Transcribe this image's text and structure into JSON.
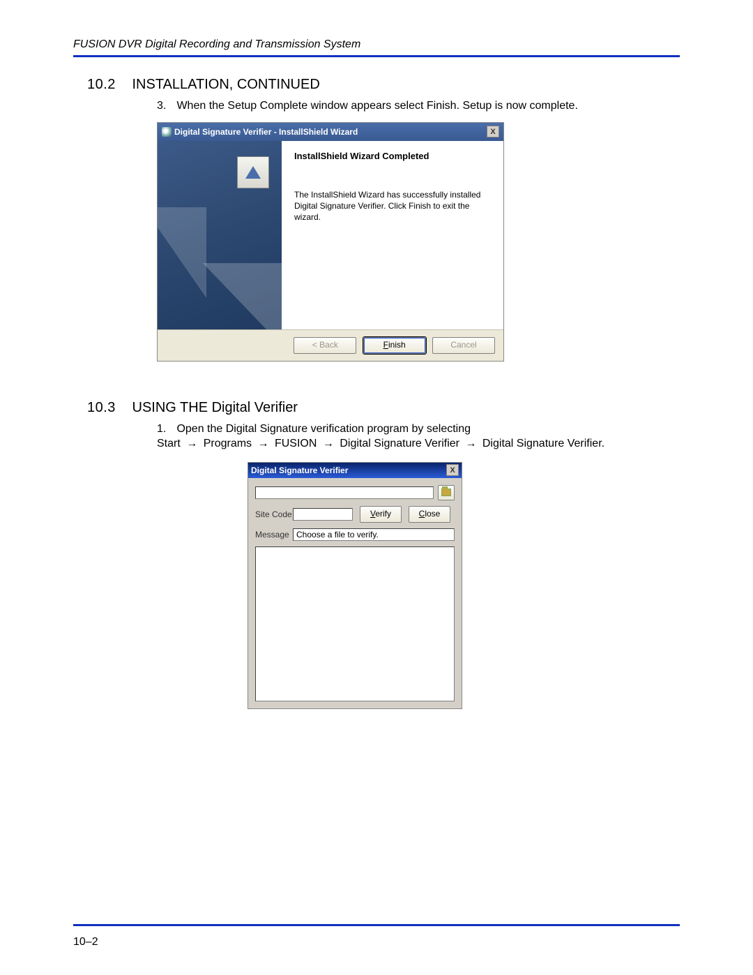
{
  "doc": {
    "header": "FUSION DVR Digital Recording and Transmission System",
    "page_number": "10–2"
  },
  "section_a": {
    "number": "10.2",
    "title": "INSTALLATION, CONTINUED",
    "step_number": "3.",
    "step_text_1": "When the ",
    "step_text_2": "Setup Complete",
    "step_text_3": " window appears select ",
    "step_text_4": "Finish",
    "step_text_5": ". Setup is now complete."
  },
  "wizard": {
    "title": "Digital Signature Verifier - InstallShield Wizard",
    "heading": "InstallShield Wizard Completed",
    "body": "The InstallShield Wizard has successfully installed Digital Signature Verifier. Click Finish to exit the wizard.",
    "back": "< Back",
    "finish": "Finish",
    "cancel": "Cancel",
    "close_x": "X"
  },
  "section_b": {
    "number": "10.3",
    "title": "USING THE Digital Verifier",
    "step_number": "1.",
    "line1": "Open the Digital Signature verification program by selecting",
    "path_start": "Start",
    "path_programs": "Programs",
    "path_fusion": "FUSION",
    "path_item1": "Digital Signature Verifier",
    "path_item2": "Digital Signature Verifier",
    "arrow": "→",
    "trailing_period": "."
  },
  "verifier": {
    "title": "Digital Signature Verifier",
    "close_x": "X",
    "path_value": "",
    "site_label": "Site Code",
    "site_value": "",
    "verify_btn": "Verify",
    "close_btn": "Close",
    "message_label": "Message",
    "message_text": "Choose a file to verify."
  }
}
